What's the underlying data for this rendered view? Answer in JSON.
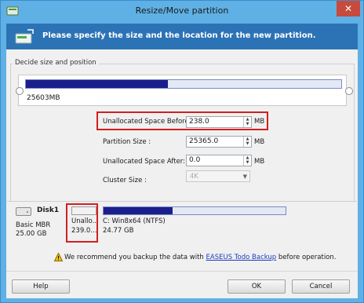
{
  "window": {
    "title": "Resize/Move partition",
    "close_glyph": "✕"
  },
  "banner": {
    "text": "Please specify the size and the location for the new partition.",
    "icon": "disk-resize-icon"
  },
  "group": {
    "label": "Decide size and position"
  },
  "slider": {
    "size_text": "25603MB",
    "fill_fraction": 0.45
  },
  "fields": {
    "unalloc_before_label": "Unallocated Space Before:",
    "unalloc_before_value": "238.0",
    "partition_size_label": "Partition Size :",
    "partition_size_value": "25365.0",
    "unalloc_after_label": "Unallocated Space After:",
    "unalloc_after_value": "0.0",
    "cluster_size_label": "Cluster Size :",
    "cluster_size_value": "4K",
    "unit": "MB"
  },
  "disk": {
    "name": "Disk1",
    "type": "Basic MBR",
    "size": "25.00 GB",
    "partitions": [
      {
        "label": "Unallo...",
        "size": "239.0..."
      },
      {
        "label": "C: Win8x64 (NTFS)",
        "size": "24.77 GB",
        "fill_fraction": 0.38
      }
    ]
  },
  "notice": {
    "prefix": "We recommend you backup the data with ",
    "link": "EASEUS Todo Backup",
    "suffix": " before operation."
  },
  "buttons": {
    "help": "Help",
    "ok": "OK",
    "cancel": "Cancel"
  },
  "colors": {
    "accent": "#1a1f8c",
    "banner": "#2c73b6",
    "highlight": "#d41e1e"
  }
}
